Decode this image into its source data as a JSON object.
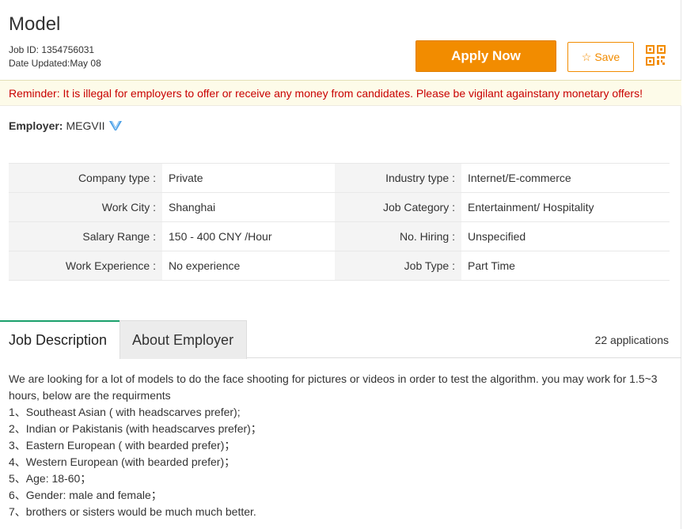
{
  "job": {
    "title": "Model",
    "job_id": "Job ID: 1354756031",
    "date_updated": "Date Updated:May 08"
  },
  "actions": {
    "apply_label": "Apply Now",
    "save_label": "Save",
    "save_icon": "star-outline-icon",
    "qr_icon": "qr-code-icon",
    "accent_color": "#f28c00"
  },
  "reminder": "Reminder: It is illegal for employers to offer or receive any money from candidates. Please be vigilant againstany monetary offers!",
  "employer": {
    "label": "Employer:",
    "name": "MEGVII",
    "badge_icon": "verified-v-icon"
  },
  "details": [
    {
      "k1": "Company type :",
      "v1": "Private",
      "k2": "Industry type :",
      "v2": "Internet/E-commerce"
    },
    {
      "k1": "Work City :",
      "v1": "Shanghai",
      "k2": "Job Category :",
      "v2": "Entertainment/ Hospitality"
    },
    {
      "k1": "Salary Range :",
      "v1": "150 - 400 CNY /Hour",
      "k2": "No. Hiring :",
      "v2": "Unspecified"
    },
    {
      "k1": "Work Experience :",
      "v1": "No experience",
      "k2": "Job Type :",
      "v2": "Part Time"
    }
  ],
  "tabs": {
    "job_description": "Job Description",
    "about_employer": "About Employer",
    "applications": "22 applications"
  },
  "description": {
    "intro": "We are looking for a lot of models to do the face shooting for pictures or videos in order to test the algorithm. you may work for 1.5~3 hours, below are the requirments",
    "items": [
      "1、Southeast Asian ( with headscarves prefer);",
      "2、Indian or Pakistanis (with headscarves prefer)；",
      "3、Eastern European ( with bearded prefer)；",
      "4、Western European (with bearded prefer)；",
      "5、Age: 18-60；",
      "6、Gender: male and female；",
      "7、brothers or sisters would be much much better."
    ]
  }
}
